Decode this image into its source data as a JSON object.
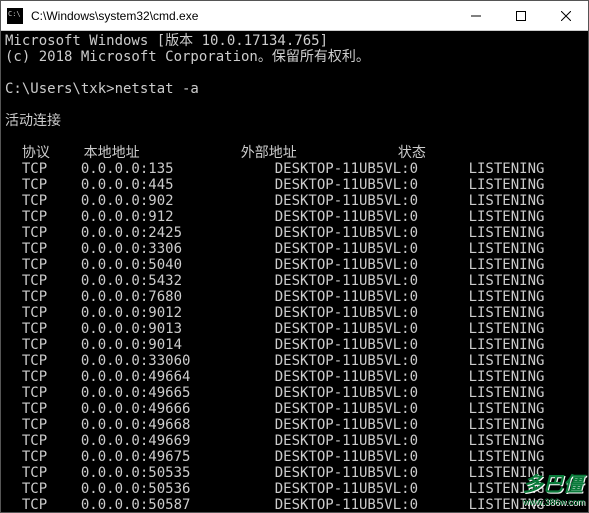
{
  "window": {
    "title": "C:\\Windows\\system32\\cmd.exe"
  },
  "terminal": {
    "banner_line1": "Microsoft Windows [版本 10.0.17134.765]",
    "banner_line2": "(c) 2018 Microsoft Corporation。保留所有权利。",
    "prompt": "C:\\Users\\txk>",
    "command": "netstat -a",
    "section_title": "活动连接",
    "headers": {
      "proto": "协议",
      "local": "本地地址",
      "foreign": "外部地址",
      "state": "状态"
    },
    "rows": [
      {
        "proto": "TCP",
        "local": "0.0.0.0:135",
        "foreign": "DESKTOP-11UB5VL:0",
        "state": "LISTENING"
      },
      {
        "proto": "TCP",
        "local": "0.0.0.0:445",
        "foreign": "DESKTOP-11UB5VL:0",
        "state": "LISTENING"
      },
      {
        "proto": "TCP",
        "local": "0.0.0.0:902",
        "foreign": "DESKTOP-11UB5VL:0",
        "state": "LISTENING"
      },
      {
        "proto": "TCP",
        "local": "0.0.0.0:912",
        "foreign": "DESKTOP-11UB5VL:0",
        "state": "LISTENING"
      },
      {
        "proto": "TCP",
        "local": "0.0.0.0:2425",
        "foreign": "DESKTOP-11UB5VL:0",
        "state": "LISTENING"
      },
      {
        "proto": "TCP",
        "local": "0.0.0.0:3306",
        "foreign": "DESKTOP-11UB5VL:0",
        "state": "LISTENING"
      },
      {
        "proto": "TCP",
        "local": "0.0.0.0:5040",
        "foreign": "DESKTOP-11UB5VL:0",
        "state": "LISTENING"
      },
      {
        "proto": "TCP",
        "local": "0.0.0.0:5432",
        "foreign": "DESKTOP-11UB5VL:0",
        "state": "LISTENING"
      },
      {
        "proto": "TCP",
        "local": "0.0.0.0:7680",
        "foreign": "DESKTOP-11UB5VL:0",
        "state": "LISTENING"
      },
      {
        "proto": "TCP",
        "local": "0.0.0.0:9012",
        "foreign": "DESKTOP-11UB5VL:0",
        "state": "LISTENING"
      },
      {
        "proto": "TCP",
        "local": "0.0.0.0:9013",
        "foreign": "DESKTOP-11UB5VL:0",
        "state": "LISTENING"
      },
      {
        "proto": "TCP",
        "local": "0.0.0.0:9014",
        "foreign": "DESKTOP-11UB5VL:0",
        "state": "LISTENING"
      },
      {
        "proto": "TCP",
        "local": "0.0.0.0:33060",
        "foreign": "DESKTOP-11UB5VL:0",
        "state": "LISTENING"
      },
      {
        "proto": "TCP",
        "local": "0.0.0.0:49664",
        "foreign": "DESKTOP-11UB5VL:0",
        "state": "LISTENING"
      },
      {
        "proto": "TCP",
        "local": "0.0.0.0:49665",
        "foreign": "DESKTOP-11UB5VL:0",
        "state": "LISTENING"
      },
      {
        "proto": "TCP",
        "local": "0.0.0.0:49666",
        "foreign": "DESKTOP-11UB5VL:0",
        "state": "LISTENING"
      },
      {
        "proto": "TCP",
        "local": "0.0.0.0:49668",
        "foreign": "DESKTOP-11UB5VL:0",
        "state": "LISTENING"
      },
      {
        "proto": "TCP",
        "local": "0.0.0.0:49669",
        "foreign": "DESKTOP-11UB5VL:0",
        "state": "LISTENING"
      },
      {
        "proto": "TCP",
        "local": "0.0.0.0:49675",
        "foreign": "DESKTOP-11UB5VL:0",
        "state": "LISTENING"
      },
      {
        "proto": "TCP",
        "local": "0.0.0.0:50535",
        "foreign": "DESKTOP-11UB5VL:0",
        "state": "LISTENING"
      },
      {
        "proto": "TCP",
        "local": "0.0.0.0:50536",
        "foreign": "DESKTOP-11UB5VL:0",
        "state": "LISTENING"
      },
      {
        "proto": "TCP",
        "local": "0.0.0.0:50587",
        "foreign": "DESKTOP-11UB5VL:0",
        "state": "LISTENING"
      }
    ]
  },
  "watermark": {
    "text": "多巴僵",
    "sub": "www.386w.com"
  }
}
